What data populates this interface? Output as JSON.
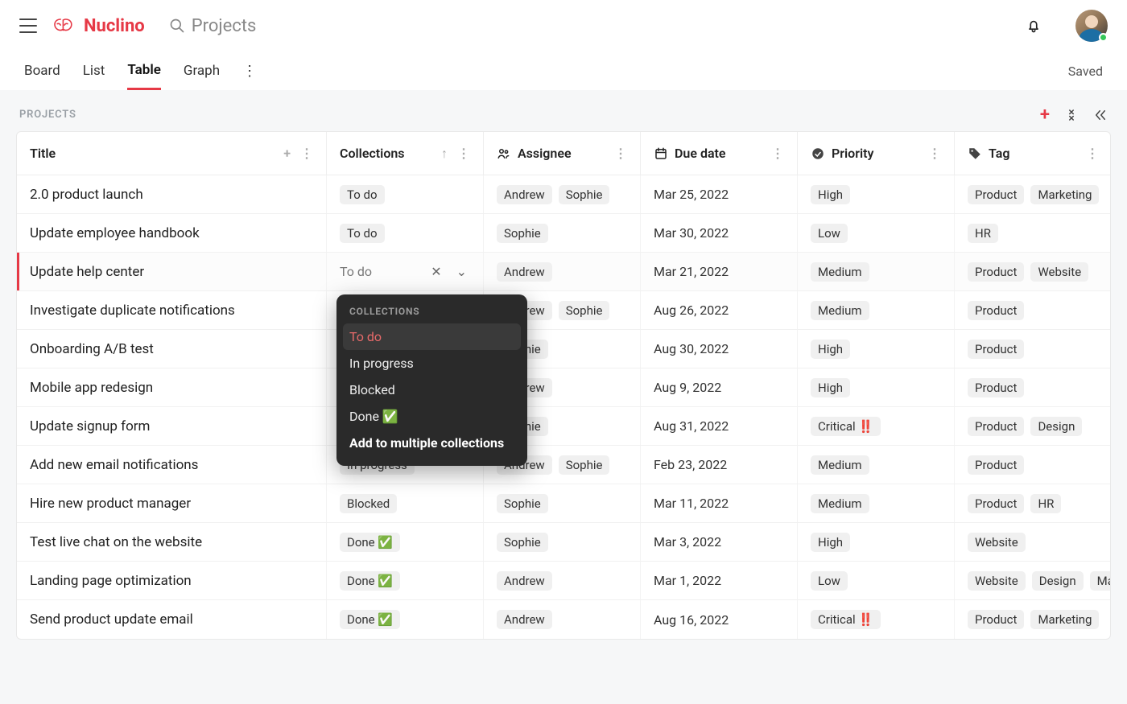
{
  "brand": "Nuclino",
  "search_placeholder": "Projects",
  "status_text": "Saved",
  "tabs": [
    "Board",
    "List",
    "Table",
    "Graph"
  ],
  "active_tab": "Table",
  "section_label": "PROJECTS",
  "columns": {
    "title": "Title",
    "collections": "Collections",
    "assignee": "Assignee",
    "due": "Due date",
    "priority": "Priority",
    "tag": "Tag"
  },
  "popup": {
    "title": "COLLECTIONS",
    "options": [
      "To do",
      "In progress",
      "Blocked",
      "Done ✅"
    ],
    "multi": "Add to multiple collections",
    "selected": "To do"
  },
  "selected_row_index": 2,
  "rows": [
    {
      "title": "2.0 product launch",
      "collection": "To do",
      "assignees": [
        "Andrew",
        "Sophie"
      ],
      "due": "Mar 25, 2022",
      "priority": "High",
      "tags": [
        "Product",
        "Marketing"
      ]
    },
    {
      "title": "Update employee handbook",
      "collection": "To do",
      "assignees": [
        "Sophie"
      ],
      "due": "Mar 30, 2022",
      "priority": "Low",
      "tags": [
        "HR"
      ]
    },
    {
      "title": "Update help center",
      "collection": "To do",
      "assignees": [
        "Andrew"
      ],
      "due": "Mar 21, 2022",
      "priority": "Medium",
      "tags": [
        "Product",
        "Website"
      ]
    },
    {
      "title": "Investigate duplicate notifications",
      "collection": "",
      "assignees": [
        "Andrew",
        "Sophie"
      ],
      "due": "Aug 26, 2022",
      "priority": "Medium",
      "tags": [
        "Product"
      ]
    },
    {
      "title": "Onboarding A/B test",
      "collection": "",
      "assignees": [
        "Sophie"
      ],
      "due": "Aug 30, 2022",
      "priority": "High",
      "tags": [
        "Product"
      ]
    },
    {
      "title": "Mobile app redesign",
      "collection": "",
      "assignees": [
        "Andrew"
      ],
      "due": "Aug 9, 2022",
      "priority": "High",
      "tags": [
        "Product"
      ]
    },
    {
      "title": "Update signup form",
      "collection": "",
      "assignees": [
        "Sophie"
      ],
      "due": "Aug 31, 2022",
      "priority": "Critical ‼️",
      "tags": [
        "Product",
        "Design"
      ]
    },
    {
      "title": "Add new email notifications",
      "collection": "In progress",
      "assignees": [
        "Andrew",
        "Sophie"
      ],
      "due": "Feb 23, 2022",
      "priority": "Medium",
      "tags": [
        "Product"
      ]
    },
    {
      "title": "Hire new product manager",
      "collection": "Blocked",
      "assignees": [
        "Sophie"
      ],
      "due": "Mar 11, 2022",
      "priority": "Medium",
      "tags": [
        "Product",
        "HR"
      ]
    },
    {
      "title": "Test live chat on the website",
      "collection": "Done ✅",
      "assignees": [
        "Sophie"
      ],
      "due": "Mar 3, 2022",
      "priority": "High",
      "tags": [
        "Website"
      ]
    },
    {
      "title": "Landing page optimization",
      "collection": "Done ✅",
      "assignees": [
        "Andrew"
      ],
      "due": "Mar 1, 2022",
      "priority": "Low",
      "tags": [
        "Website",
        "Design",
        "Marketing"
      ]
    },
    {
      "title": "Send product update email",
      "collection": "Done ✅",
      "assignees": [
        "Andrew"
      ],
      "due": "Aug 16, 2022",
      "priority": "Critical ‼️",
      "tags": [
        "Product",
        "Marketing"
      ]
    }
  ]
}
